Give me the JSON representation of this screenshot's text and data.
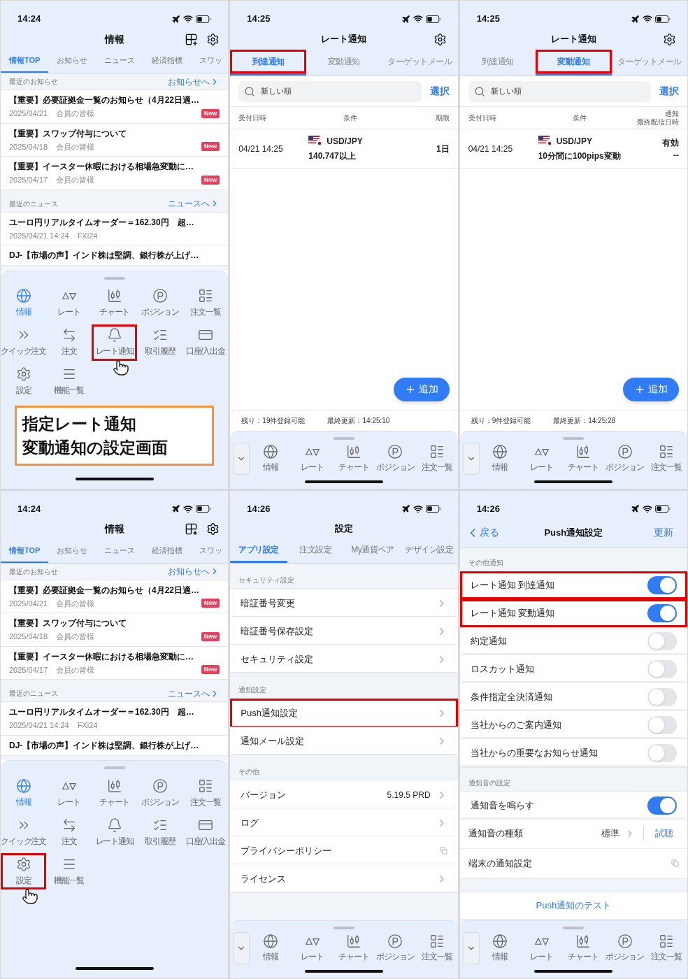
{
  "panels": [
    {
      "kind": "info",
      "time": "14:24",
      "title": "情報",
      "tabs": [
        {
          "label": "情報TOP",
          "selected": true
        },
        {
          "label": "お知らせ",
          "selected": false
        },
        {
          "label": "ニュース",
          "selected": false
        },
        {
          "label": "経済指標",
          "selected": false
        },
        {
          "label": "スワッ",
          "selected": false
        }
      ],
      "notices_section": {
        "label": "最近のお知らせ",
        "link": "お知らせへ"
      },
      "notices": [
        {
          "title": "【重要】必要証拠金一覧のお知らせ（4月22日適…",
          "date": "2025/04/21",
          "audience": "会員の皆様",
          "badge": "New"
        },
        {
          "title": "【重要】スワップ付与について",
          "date": "2025/04/18",
          "audience": "会員の皆様",
          "badge": "New"
        },
        {
          "title": "【重要】イースター休暇における相場急変動に…",
          "date": "2025/04/17",
          "audience": "会員の皆様",
          "badge": "New"
        }
      ],
      "news_section": {
        "label": "最近のニュース",
        "link": "ニュースへ"
      },
      "news": [
        {
          "title": "ユーロ円リアルタイムオーダー＝162.30円　超…",
          "date": "2025/04/21 14:24",
          "source": "FXi24"
        },
        {
          "title": "DJ-【市場の声】インド株は堅調、銀行株が上げ…"
        }
      ],
      "menu": [
        {
          "label": "情報",
          "selected": true,
          "highlighted": false
        },
        {
          "label": "レート",
          "selected": false,
          "highlighted": false
        },
        {
          "label": "チャート",
          "selected": false,
          "highlighted": false
        },
        {
          "label": "ポジション",
          "selected": false,
          "highlighted": false
        },
        {
          "label": "注文一覧",
          "selected": false,
          "highlighted": false
        },
        {
          "label": "クイック注文",
          "selected": false,
          "highlighted": false
        },
        {
          "label": "注文",
          "selected": false,
          "highlighted": false
        },
        {
          "label": "レート通知",
          "selected": false,
          "highlighted": true
        },
        {
          "label": "取引履歴",
          "selected": false,
          "highlighted": false
        },
        {
          "label": "口座/入出金",
          "selected": false,
          "highlighted": false
        },
        {
          "label": "設定",
          "selected": false,
          "highlighted": false
        },
        {
          "label": "機能一覧",
          "selected": false,
          "highlighted": false
        }
      ],
      "callout": {
        "lines": [
          "指定レート通知",
          "変動通知の設定画面"
        ]
      }
    },
    {
      "kind": "rate",
      "time": "14:25",
      "title": "レート通知",
      "tabs": [
        {
          "label": "到達通知",
          "selected": true,
          "highlighted": true
        },
        {
          "label": "変動通知",
          "selected": false,
          "highlighted": false
        },
        {
          "label": "ターゲットメール",
          "selected": false,
          "highlighted": false
        }
      ],
      "sort": "新しい順",
      "select": "選択",
      "columns": [
        {
          "lines": [
            "受付日時"
          ]
        },
        {
          "lines": [
            "条件"
          ]
        },
        {
          "lines": [
            "期限"
          ]
        }
      ],
      "rows": [
        {
          "date": "04/21 14:25",
          "pair": "USD/JPY",
          "condition": "140.747以上",
          "detail": [
            "1日"
          ]
        }
      ],
      "add": "追加",
      "remaining": "残り：19件登録可能",
      "updated": "最終更新：14:25:10",
      "dock": [
        "情報",
        "レート",
        "チャート",
        "ポジション",
        "注文一覧"
      ]
    },
    {
      "kind": "rate",
      "time": "14:25",
      "title": "レート通知",
      "tabs": [
        {
          "label": "到達通知",
          "selected": false,
          "highlighted": false
        },
        {
          "label": "変動通知",
          "selected": true,
          "highlighted": true
        },
        {
          "label": "ターゲットメール",
          "selected": false,
          "highlighted": false
        }
      ],
      "sort": "新しい順",
      "select": "選択",
      "columns": [
        {
          "lines": [
            "受付日時"
          ]
        },
        {
          "lines": [
            "条件"
          ]
        },
        {
          "lines": [
            "通知",
            "最終配信日時"
          ]
        }
      ],
      "rows": [
        {
          "date": "04/21 14:25",
          "pair": "USD/JPY",
          "condition": "10分間に100pips変動",
          "detail": [
            "有効",
            "--"
          ]
        }
      ],
      "add": "追加",
      "remaining": "残り：9件登録可能",
      "updated": "最終更新：14:25:28",
      "dock": [
        "情報",
        "レート",
        "チャート",
        "ポジション",
        "注文一覧"
      ]
    },
    {
      "kind": "info",
      "time": "14:24",
      "title": "情報",
      "tabs": [
        {
          "label": "情報TOP",
          "selected": true
        },
        {
          "label": "お知らせ",
          "selected": false
        },
        {
          "label": "ニュース",
          "selected": false
        },
        {
          "label": "経済指標",
          "selected": false
        },
        {
          "label": "スワッ",
          "selected": false
        }
      ],
      "notices_section": {
        "label": "最近のお知らせ",
        "link": "お知らせへ"
      },
      "notices": [
        {
          "title": "【重要】必要証拠金一覧のお知らせ（4月22日適…",
          "date": "2025/04/21",
          "audience": "会員の皆様",
          "badge": "New"
        },
        {
          "title": "【重要】スワップ付与について",
          "date": "2025/04/18",
          "audience": "会員の皆様",
          "badge": "New"
        },
        {
          "title": "【重要】イースター休暇における相場急変動に…",
          "date": "2025/04/17",
          "audience": "会員の皆様",
          "badge": "New"
        }
      ],
      "news_section": {
        "label": "最近のニュース",
        "link": "ニュースへ"
      },
      "news": [
        {
          "title": "ユーロ円リアルタイムオーダー＝162.30円　超…",
          "date": "2025/04/21 14:24",
          "source": "FXi24"
        },
        {
          "title": "DJ-【市場の声】インド株は堅調、銀行株が上げ…"
        }
      ],
      "menu": [
        {
          "label": "情報",
          "selected": true,
          "highlighted": false
        },
        {
          "label": "レート",
          "selected": false,
          "highlighted": false
        },
        {
          "label": "チャート",
          "selected": false,
          "highlighted": false
        },
        {
          "label": "ポジション",
          "selected": false,
          "highlighted": false
        },
        {
          "label": "注文一覧",
          "selected": false,
          "highlighted": false
        },
        {
          "label": "クイック注文",
          "selected": false,
          "highlighted": false
        },
        {
          "label": "注文",
          "selected": false,
          "highlighted": false
        },
        {
          "label": "レート通知",
          "selected": false,
          "highlighted": false
        },
        {
          "label": "取引履歴",
          "selected": false,
          "highlighted": false
        },
        {
          "label": "口座/入出金",
          "selected": false,
          "highlighted": false
        },
        {
          "label": "設定",
          "selected": false,
          "highlighted": true
        },
        {
          "label": "機能一覧",
          "selected": false,
          "highlighted": false
        }
      ]
    },
    {
      "kind": "settings",
      "time": "14:26",
      "title": "設定",
      "tabs": [
        {
          "label": "アプリ設定",
          "selected": true
        },
        {
          "label": "注文設定",
          "selected": false
        },
        {
          "label": "My通貨ペア",
          "selected": false
        },
        {
          "label": "デザイン設定",
          "selected": false
        }
      ],
      "sections": [
        {
          "header": "セキュリティ設定",
          "items": [
            {
              "kind": "link",
              "label": "暗証番号変更",
              "highlighted": false
            },
            {
              "kind": "link",
              "label": "暗証番号保存設定",
              "highlighted": false
            },
            {
              "kind": "link",
              "label": "セキュリティ設定",
              "highlighted": false
            }
          ]
        },
        {
          "header": "通知設定",
          "items": [
            {
              "kind": "link",
              "label": "Push通知設定",
              "highlighted": true
            },
            {
              "kind": "link",
              "label": "通知メール設定",
              "highlighted": false
            }
          ]
        },
        {
          "header": "その他",
          "items": [
            {
              "kind": "link",
              "label": "バージョン",
              "value": "5.19.5 PRD",
              "highlighted": false
            },
            {
              "kind": "link",
              "label": "ログ",
              "highlighted": false
            },
            {
              "kind": "external",
              "label": "プライバシーポリシー",
              "highlighted": false
            },
            {
              "kind": "link",
              "label": "ライセンス",
              "highlighted": false
            }
          ]
        }
      ],
      "dock": [
        "情報",
        "レート",
        "チャート",
        "ポジション",
        "注文一覧"
      ]
    },
    {
      "kind": "push",
      "time": "14:26",
      "back": "戻る",
      "title": "Push通知設定",
      "action": "更新",
      "sections": [
        {
          "header": "その他通知",
          "items": [
            {
              "kind": "toggle",
              "label": "レート通知 到達通知",
              "on": true,
              "highlighted": true
            },
            {
              "kind": "toggle",
              "label": "レート通知 変動通知",
              "on": true,
              "highlighted": true
            },
            {
              "kind": "toggle",
              "label": "約定通知",
              "on": false,
              "highlighted": false
            },
            {
              "kind": "toggle",
              "label": "ロスカット通知",
              "on": false,
              "highlighted": false
            },
            {
              "kind": "toggle",
              "label": "条件指定全決済通知",
              "on": false,
              "highlighted": false
            },
            {
              "kind": "toggle",
              "label": "当社からのご案内通知",
              "on": false,
              "highlighted": false
            },
            {
              "kind": "toggle",
              "label": "当社からの重要なお知らせ通知",
              "on": false,
              "highlighted": false
            }
          ]
        },
        {
          "header": "通知音の設定",
          "items": [
            {
              "kind": "toggle",
              "label": "通知音を鳴らす",
              "on": true,
              "highlighted": false
            },
            {
              "kind": "select",
              "label": "通知音の種類",
              "value": "標準",
              "action": "試聴"
            },
            {
              "kind": "external",
              "label": "端末の通知設定"
            }
          ]
        }
      ],
      "test": "Push通知のテスト",
      "dock": [
        "情報",
        "レート",
        "チャート",
        "ポジション",
        "注文一覧"
      ]
    }
  ]
}
